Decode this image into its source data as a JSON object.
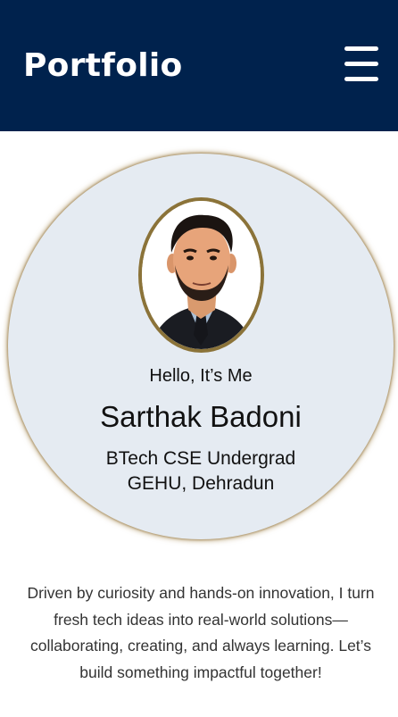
{
  "header": {
    "brand": "Portfolio",
    "menu_icon": "hamburger-menu-icon",
    "background": "#00224d"
  },
  "hero": {
    "greeting": "Hello, It’s Me",
    "name": "Sarthak Badoni",
    "role_line1": "BTech CSE Undergrad",
    "role_line2": "GEHU, Dehradun",
    "circle_color": "#e5ebf2",
    "avatar_border": "#8b7339"
  },
  "about": {
    "text": "Driven by curiosity and hands-on innovation, I turn fresh tech ideas into real-world solutions—collaborating, creating, and always learning. Let’s build something impactful together!"
  }
}
